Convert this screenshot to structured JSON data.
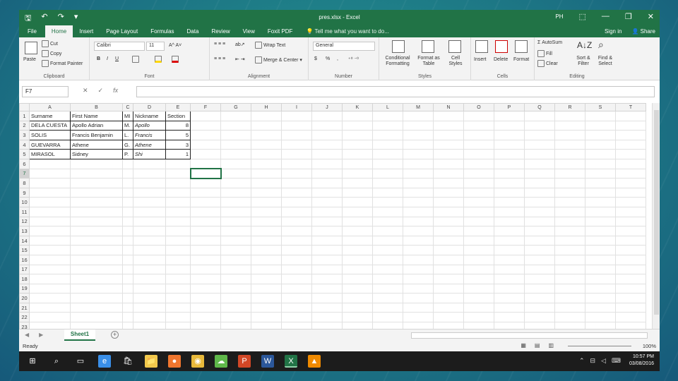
{
  "window": {
    "title": "pres.xlsx - Excel",
    "user_initials": "PH",
    "qat": {
      "save": "🖫",
      "undo": "↶",
      "redo": "↷",
      "customize": "▾"
    },
    "controls": {
      "ribbon_display": "⬚",
      "minimize": "—",
      "restore": "❐",
      "close": "✕"
    }
  },
  "ribbon": {
    "tabs": [
      "File",
      "Home",
      "Insert",
      "Page Layout",
      "Formulas",
      "Data",
      "Review",
      "View",
      "Foxit PDF"
    ],
    "active_tab": "Home",
    "tell_me": "Tell me what you want to do...",
    "sign_in": "Sign in",
    "share": "Share",
    "clipboard": {
      "label": "Clipboard",
      "paste": "Paste",
      "cut": "Cut",
      "copy": "Copy",
      "format_painter": "Format Painter"
    },
    "font": {
      "label": "Font",
      "font_name": "Calibri",
      "font_size": "11",
      "bold": "B",
      "italic": "I",
      "underline": "U"
    },
    "alignment": {
      "label": "Alignment",
      "wrap_text": "Wrap Text",
      "merge_center": "Merge & Center"
    },
    "number": {
      "label": "Number",
      "format": "General",
      "currency": "$",
      "percent": "%"
    },
    "styles": {
      "label": "Styles",
      "conditional": "Conditional Formatting",
      "format_table": "Format as Table",
      "cell_styles": "Cell Styles"
    },
    "cells": {
      "label": "Cells",
      "insert": "Insert",
      "delete": "Delete",
      "format": "Format"
    },
    "editing": {
      "label": "Editing",
      "autosum": "AutoSum",
      "fill": "Fill",
      "clear": "Clear",
      "sort_filter": "Sort & Filter",
      "find_select": "Find & Select"
    }
  },
  "formula_bar": {
    "name_box": "F7",
    "cancel": "✕",
    "enter": "✓",
    "fx": "fx",
    "value": ""
  },
  "sheet": {
    "columns": [
      "A",
      "B",
      "C",
      "D",
      "E",
      "F",
      "G",
      "H",
      "I",
      "J",
      "K",
      "L",
      "M",
      "N",
      "O",
      "P",
      "Q",
      "R",
      "S",
      "T"
    ],
    "selected_column": "F",
    "selected_row": 7,
    "row_count": 23,
    "rows": [
      [
        "Surname",
        "First Name",
        "MI",
        "Nickname",
        "Section"
      ],
      [
        "DELA CUESTA",
        "Apollo Adrian",
        "M.",
        "Apollo",
        "8"
      ],
      [
        "SOLIS",
        "Francis Benjamin",
        "L.",
        "Francis",
        "5"
      ],
      [
        "GUEVARRA",
        "Athene",
        "G.",
        "Athene",
        "3"
      ],
      [
        "MIRASOL",
        "Sidney",
        "P.",
        "Shi",
        "1"
      ]
    ]
  },
  "sheet_tabs": {
    "active": "Sheet1",
    "add": "+",
    "prev": "◀",
    "next": "▶"
  },
  "status": {
    "ready": "Ready",
    "zoom": "100%"
  },
  "taskbar": {
    "time": "10:57 PM",
    "date": "03/08/2016",
    "icons": [
      "windows-start",
      "search",
      "task-view",
      "edge",
      "store",
      "file-explorer",
      "firefox",
      "chrome",
      "cloud-app",
      "powerpoint",
      "word",
      "excel",
      "vlc"
    ]
  },
  "colors": {
    "excel_green": "#217346",
    "taskbar": "#1c1c1c"
  }
}
